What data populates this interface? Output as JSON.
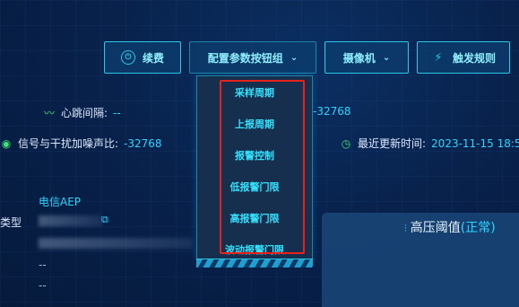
{
  "toolbar": {
    "renew_label": "续费",
    "param_group_label": "配置参数按钮组",
    "camera_label": "摄像机",
    "trigger_rules_label": "触发规则"
  },
  "dropdown": {
    "items": [
      "采样周期",
      "上报周期",
      "报警控制",
      "低报警门限",
      "高报警门限",
      "波动报警门限"
    ]
  },
  "stats": {
    "heartbeat_label": "心跳间隔:",
    "heartbeat_value": "--",
    "partial_value": "-32768",
    "snr_label": "信号与干扰加噪声比:",
    "snr_value": "-32768",
    "last_update_label": "最近更新时间:",
    "last_update_value": "2023-11-15 18:5"
  },
  "info": {
    "platform": "电信AEP",
    "type_label": "类型",
    "line1": "--",
    "line2": "--"
  },
  "panel": {
    "title_main": "高压阈值",
    "title_status": "(正常)"
  },
  "colors": {
    "accent": "#29d6ff",
    "button_border": "#27c9e6",
    "highlight_frame": "#e8221b"
  }
}
